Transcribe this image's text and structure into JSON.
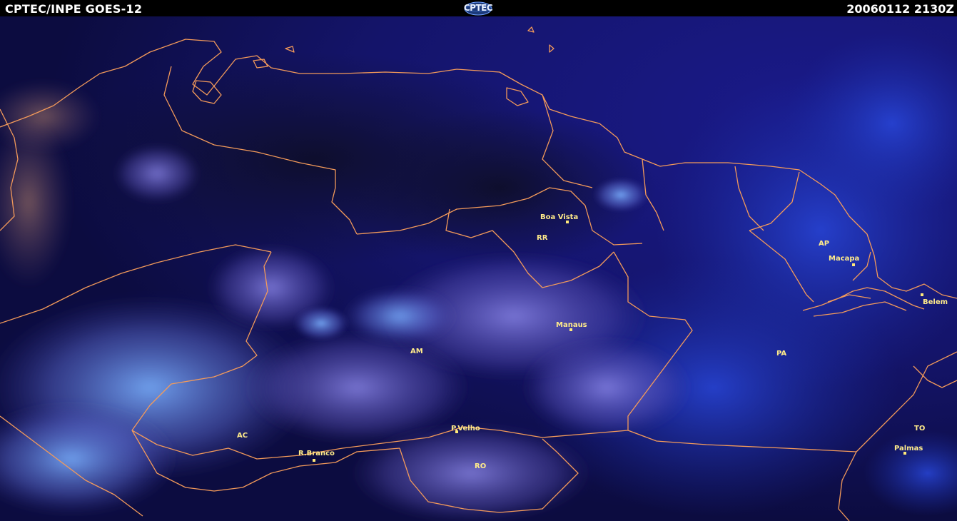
{
  "header": {
    "source_label": "CPTEC/INPE  GOES-12",
    "logo_text": "CPTEC",
    "timestamp": "20060112  2130Z"
  },
  "colors": {
    "border": "#f39a5a",
    "label": "#ffeb8a",
    "background": "#0a0a3a"
  },
  "map": {
    "cities": [
      {
        "name": "Boa Vista"
      },
      {
        "name": "Macapa"
      },
      {
        "name": "Belem"
      },
      {
        "name": "Manaus"
      },
      {
        "name": "P.Velho"
      },
      {
        "name": "R.Branco"
      },
      {
        "name": "Palmas"
      }
    ],
    "states": [
      {
        "code": "RR"
      },
      {
        "code": "AP"
      },
      {
        "code": "AM"
      },
      {
        "code": "PA"
      },
      {
        "code": "AC"
      },
      {
        "code": "RO"
      },
      {
        "code": "TO"
      }
    ]
  }
}
